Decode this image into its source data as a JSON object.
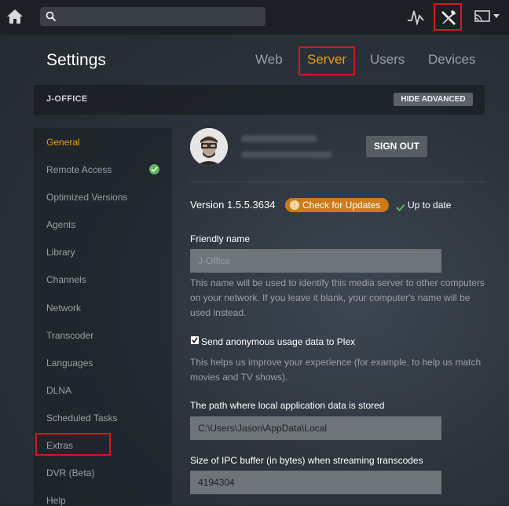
{
  "topbar": {
    "icons": [
      "home-icon",
      "search-icon",
      "activity-icon",
      "tools-icon",
      "cast-icon"
    ],
    "search_value": ""
  },
  "page": {
    "title": "Settings",
    "tabs": [
      "Web",
      "Server",
      "Users",
      "Devices"
    ],
    "active_tab": "Server"
  },
  "server": {
    "name": "J-OFFICE",
    "hide_advanced": "HIDE ADVANCED"
  },
  "sidebar": {
    "items": [
      "General",
      "Remote Access",
      "Optimized Versions",
      "Agents",
      "Library",
      "Channels",
      "Network",
      "Transcoder",
      "Languages",
      "DLNA",
      "Scheduled Tasks",
      "Extras",
      "DVR (Beta)",
      "Help"
    ],
    "active": "General"
  },
  "account": {
    "sign_out": "SIGN OUT"
  },
  "version": {
    "text": "Version 1.5.5.3634",
    "check_updates": "Check for Updates",
    "status": "Up to date"
  },
  "general": {
    "friendly_name_label": "Friendly name",
    "friendly_name_placeholder": "J-Office",
    "friendly_name_help": "This name will be used to identify this media server to other computers on your network. If you leave it blank, your computer's name will be used instead.",
    "anon_label": "Send anonymous usage data to Plex",
    "anon_checked": true,
    "anon_help": "This helps us improve your experience (for example, to help us match movies and TV shows).",
    "path_label": "The path where local application data is stored",
    "path_value": "C:\\Users\\Jason\\AppData\\Local",
    "ipc_label": "Size of IPC buffer (in bytes) when streaming transcodes",
    "ipc_value": "4194304"
  },
  "colors": {
    "accent": "#e5a00d",
    "highlight": "#d6171e",
    "success": "#5cb85c",
    "update_button": "#cc7b19"
  }
}
